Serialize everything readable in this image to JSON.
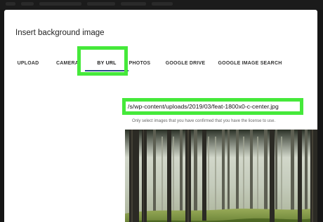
{
  "dialog": {
    "title": "Insert background image"
  },
  "tabs": [
    {
      "label": "UPLOAD"
    },
    {
      "label": "CAMERA"
    },
    {
      "label": "BY URL"
    },
    {
      "label": "PHOTOS"
    },
    {
      "label": "GOOGLE DRIVE"
    },
    {
      "label": "GOOGLE IMAGE SEARCH"
    }
  ],
  "active_tab": "BY URL",
  "url_field": {
    "value": "/s/wp-content/uploads/2019/03/feat-1800x0-c-center.jpg"
  },
  "notice": "Only select images that you have confirmed that you have the license to use.",
  "highlight_color": "#45e93a",
  "preview": {
    "icon": "forest-image-preview"
  }
}
